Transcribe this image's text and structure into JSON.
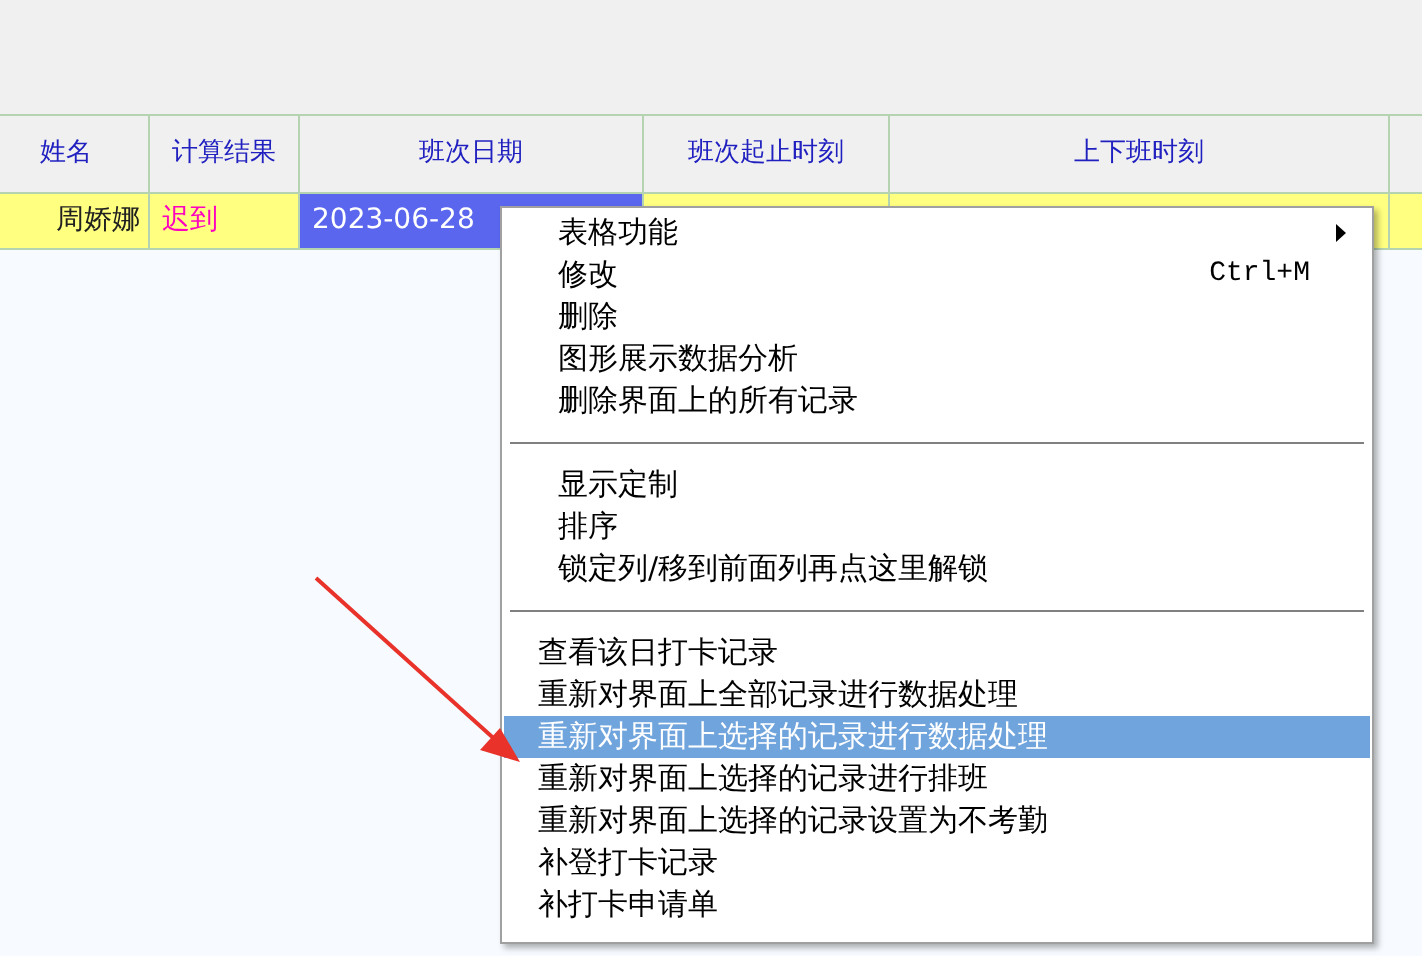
{
  "table": {
    "columns": [
      {
        "label": "姓名"
      },
      {
        "label": "计算结果"
      },
      {
        "label": "班次日期"
      },
      {
        "label": "班次起止时刻"
      },
      {
        "label": "上下班时刻"
      }
    ],
    "rows": [
      {
        "cells": [
          {
            "text": "周娇娜",
            "kind": "plain"
          },
          {
            "text": "迟到",
            "kind": "alert"
          },
          {
            "text": "2023-06-28",
            "kind": "selected"
          },
          {
            "text": "",
            "kind": "plain"
          },
          {
            "text": "",
            "kind": "plain"
          },
          {
            "text": "",
            "kind": "plain"
          }
        ]
      }
    ]
  },
  "context_menu": {
    "sections": [
      {
        "items": [
          {
            "label": "表格功能",
            "submenu": true,
            "selected": false
          },
          {
            "label": "修改",
            "shortcut": "Ctrl+M",
            "selected": false
          },
          {
            "label": "删除",
            "selected": false
          },
          {
            "label": "图形展示数据分析",
            "selected": false
          },
          {
            "label": "删除界面上的所有记录",
            "selected": false
          }
        ]
      },
      {
        "items": [
          {
            "label": "显示定制",
            "selected": false
          },
          {
            "label": "排序",
            "selected": false
          },
          {
            "label": "锁定列/移到前面列再点这里解锁",
            "selected": false
          }
        ]
      },
      {
        "items": [
          {
            "label": "查看该日打卡记录",
            "selected": false
          },
          {
            "label": "重新对界面上全部记录进行数据处理",
            "selected": false
          },
          {
            "label": "重新对界面上选择的记录进行数据处理",
            "selected": true
          },
          {
            "label": "重新对界面上选择的记录进行排班",
            "selected": false
          },
          {
            "label": "重新对界面上选择的记录设置为不考勤",
            "selected": false
          },
          {
            "label": "补登打卡记录",
            "selected": false
          },
          {
            "label": "补打卡申请单",
            "selected": false
          }
        ]
      }
    ]
  }
}
